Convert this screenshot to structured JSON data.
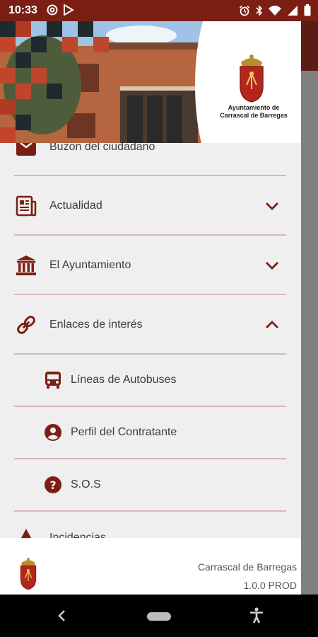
{
  "status_bar": {
    "time": "10:33",
    "left_icons": [
      "at-sign-icon",
      "play-store-icon"
    ],
    "right_icons": [
      "alarm-icon",
      "bluetooth-icon",
      "wifi-icon",
      "signal-icon",
      "battery-icon"
    ]
  },
  "header": {
    "logo_text_line1": "Ayuntamiento de",
    "logo_text_line2": "Carrascal de Barregas"
  },
  "menu": {
    "items": [
      {
        "label": "Buzon del ciudadano",
        "icon": "mailbox-icon"
      },
      {
        "label": "Actualidad",
        "icon": "newspaper-icon",
        "state": "collapsed"
      },
      {
        "label": "El Ayuntamiento",
        "icon": "town-hall-icon",
        "state": "collapsed"
      },
      {
        "label": "Enlaces de interés",
        "icon": "link-icon",
        "state": "expanded"
      }
    ],
    "subitems": [
      {
        "label": "Líneas de Autobuses",
        "icon": "bus-icon"
      },
      {
        "label": "Perfil del Contratante",
        "icon": "account-circle-icon"
      },
      {
        "label": "S.O.S",
        "icon": "help-circle-icon"
      }
    ],
    "partial_item_label": "Incidencias"
  },
  "footer": {
    "name": "Carrascal de Barregas",
    "version": "1.0.0 PROD"
  },
  "colors": {
    "brand": "#7b1f14",
    "divider": "#d9b8b3",
    "drawer_bg": "#efefef"
  }
}
